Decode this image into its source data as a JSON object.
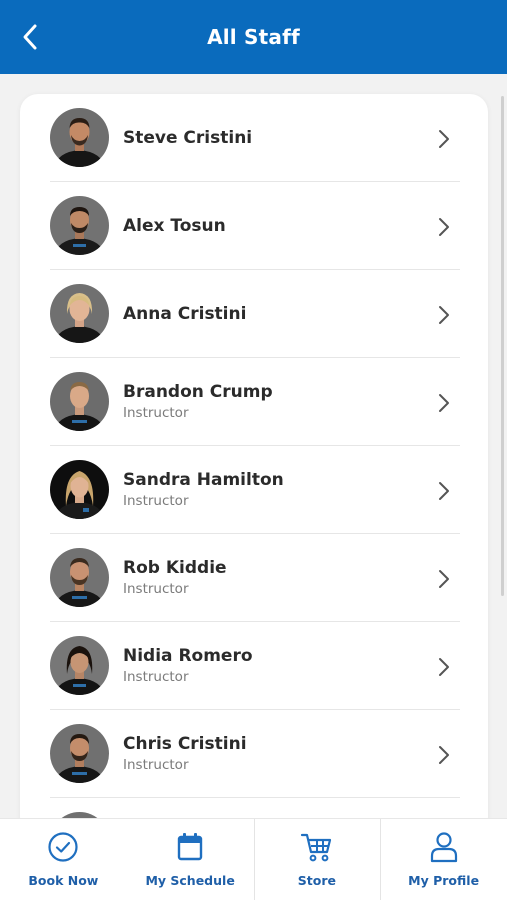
{
  "header": {
    "title": "All Staff",
    "back_icon": "chevron-left-icon"
  },
  "colors": {
    "brand": "#0a6bbd",
    "nav_accent": "#1f5fa8"
  },
  "staff": [
    {
      "name": "Steve Cristini",
      "role": ""
    },
    {
      "name": "Alex Tosun",
      "role": ""
    },
    {
      "name": "Anna Cristini",
      "role": ""
    },
    {
      "name": "Brandon Crump",
      "role": "Instructor"
    },
    {
      "name": "Sandra Hamilton",
      "role": "Instructor"
    },
    {
      "name": "Rob Kiddie",
      "role": "Instructor"
    },
    {
      "name": "Nidia Romero",
      "role": "Instructor"
    },
    {
      "name": "Chris Cristini",
      "role": "Instructor"
    }
  ],
  "bottom_nav": {
    "items": [
      {
        "label": "Book Now",
        "icon": "check-circle-icon"
      },
      {
        "label": "My Schedule",
        "icon": "calendar-icon"
      },
      {
        "label": "Store",
        "icon": "cart-icon"
      },
      {
        "label": "My Profile",
        "icon": "user-icon"
      }
    ]
  }
}
